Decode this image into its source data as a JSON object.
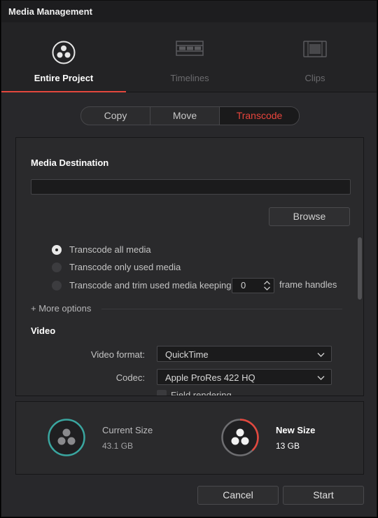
{
  "window": {
    "title": "Media Management"
  },
  "tabs": [
    {
      "label": "Entire Project",
      "icon": "resolve-logo-icon",
      "active": true
    },
    {
      "label": "Timelines",
      "icon": "timeline-icon",
      "active": false
    },
    {
      "label": "Clips",
      "icon": "clip-icon",
      "active": false
    }
  ],
  "modes": {
    "copy": "Copy",
    "move": "Move",
    "transcode": "Transcode",
    "selected": "Transcode"
  },
  "destination": {
    "heading": "Media Destination",
    "value": "",
    "browse_label": "Browse"
  },
  "options": {
    "all": "Transcode all media",
    "used": "Transcode only used media",
    "trim": "Transcode and trim used media keeping",
    "selected": "Transcode all media",
    "handles_value": "0",
    "handles_suffix": "frame handles",
    "more": "+ More options"
  },
  "video": {
    "heading": "Video",
    "format_label": "Video format:",
    "format_value": "QuickTime",
    "codec_label": "Codec:",
    "codec_value": "Apple ProRes 422 HQ",
    "field_rendering": "Field rendering"
  },
  "size": {
    "current_label": "Current Size",
    "current_value": "43.1 GB",
    "new_label": "New Size",
    "new_value": "13 GB"
  },
  "footer": {
    "cancel": "Cancel",
    "start": "Start"
  },
  "colors": {
    "accent": "#e4473d",
    "teal": "#3aa6a0"
  }
}
